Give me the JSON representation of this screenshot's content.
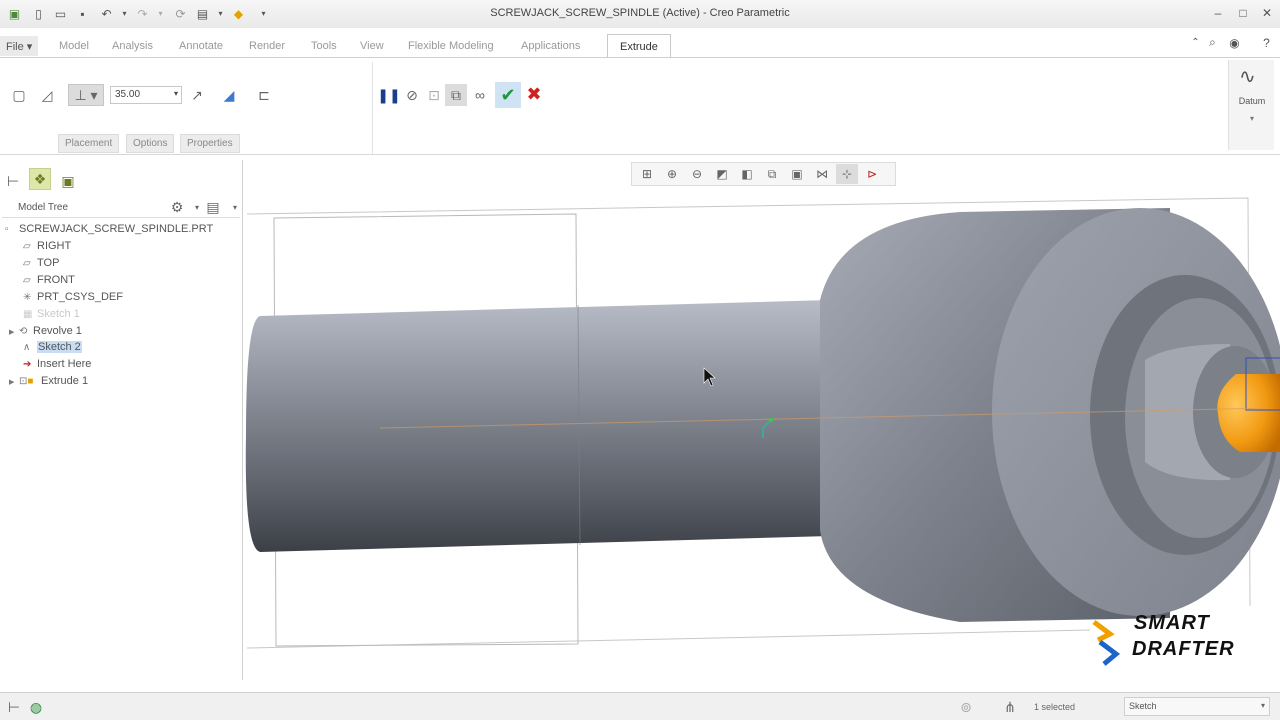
{
  "window": {
    "title": "SCREWJACK_SCREW_SPINDLE (Active) - Creo Parametric"
  },
  "tabs": {
    "file": "File",
    "items": [
      "Model",
      "Analysis",
      "Annotate",
      "Render",
      "Tools",
      "View",
      "Flexible Modeling",
      "Applications"
    ],
    "active": "Extrude"
  },
  "ribbon": {
    "depth_value": "35.00",
    "subtabs": [
      "Placement",
      "Options",
      "Properties"
    ],
    "datum_label": "Datum"
  },
  "model_tree": {
    "header": "Model Tree",
    "nodes": [
      {
        "label": "SCREWJACK_SCREW_SPINDLE.PRT",
        "icon": "part-icon"
      },
      {
        "label": "RIGHT",
        "icon": "datum-plane-icon"
      },
      {
        "label": "TOP",
        "icon": "datum-plane-icon"
      },
      {
        "label": "FRONT",
        "icon": "datum-plane-icon"
      },
      {
        "label": "PRT_CSYS_DEF",
        "icon": "csys-icon"
      },
      {
        "label": "Sketch 1",
        "icon": "sketch-icon"
      },
      {
        "label": "Revolve 1",
        "icon": "revolve-icon"
      },
      {
        "label": "Sketch 2",
        "icon": "sketch-icon"
      },
      {
        "label": "Insert Here",
        "icon": "insert-arrow-icon"
      },
      {
        "label": "Extrude 1",
        "icon": "extrude-icon"
      }
    ]
  },
  "status": {
    "selected": "1 selected",
    "filter": "Sketch"
  },
  "watermark": {
    "line1": "SMART",
    "line2": "DRAFTER"
  },
  "colors": {
    "accent_orange": "#f29a12",
    "confirm_green": "#1a9a3a",
    "cancel_red": "#d02020",
    "selection_highlight": "#c8ddf4"
  }
}
